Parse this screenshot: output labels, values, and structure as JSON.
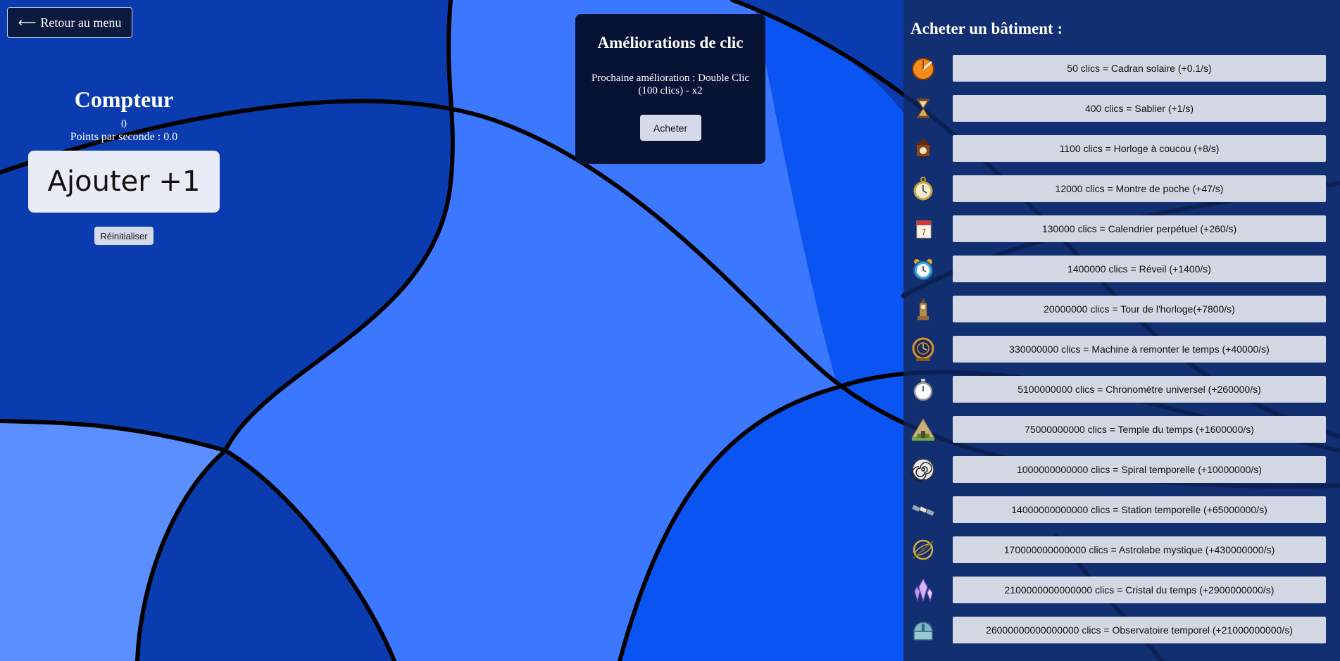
{
  "nav": {
    "back_label": "Retour au menu"
  },
  "counter": {
    "title": "Compteur",
    "value": "0",
    "per_second": "Points par seconde : 0.0",
    "add_label": "Ajouter +1",
    "reset_label": "Réinitialiser"
  },
  "upgrades": {
    "title": "Améliorations de clic",
    "next": "Prochaine amélioration : Double Clic (100 clics) - x2",
    "buy_label": "Acheter"
  },
  "shop": {
    "title": "Acheter un bâtiment :",
    "items": [
      {
        "icon": "sundial-icon",
        "label": "50 clics = Cadran solaire (+0.1/s)"
      },
      {
        "icon": "hourglass-icon",
        "label": "400 clics = Sablier (+1/s)"
      },
      {
        "icon": "cuckoo-clock-icon",
        "label": "1100 clics = Horloge à coucou (+8/s)"
      },
      {
        "icon": "pocket-watch-icon",
        "label": "12000 clics = Montre de poche (+47/s)"
      },
      {
        "icon": "calendar-icon",
        "label": "130000 clics = Calendrier perpétuel (+260/s)"
      },
      {
        "icon": "alarm-clock-icon",
        "label": "1400000 clics = Réveil (+1400/s)"
      },
      {
        "icon": "clock-tower-icon",
        "label": "20000000 clics = Tour de l'horloge(+7800/s)"
      },
      {
        "icon": "time-machine-icon",
        "label": "330000000 clics = Machine à remonter le temps (+40000/s)"
      },
      {
        "icon": "stopwatch-icon",
        "label": "5100000000 clics = Chronomètre universel (+260000/s)"
      },
      {
        "icon": "temple-icon",
        "label": "75000000000 clics = Temple du temps (+1600000/s)"
      },
      {
        "icon": "spiral-icon",
        "label": "1000000000000 clics = Spiral temporelle (+10000000/s)"
      },
      {
        "icon": "space-station-icon",
        "label": "14000000000000 clics = Station temporelle (+65000000/s)"
      },
      {
        "icon": "astrolabe-icon",
        "label": "170000000000000 clics = Astrolabe mystique (+430000000/s)"
      },
      {
        "icon": "crystal-icon",
        "label": "2100000000000000 clics = Cristal du temps (+2900000000/s)"
      },
      {
        "icon": "observatory-icon",
        "label": "26000000000000000 clics = Observatoire temporel (+21000000000/s)"
      }
    ]
  }
}
